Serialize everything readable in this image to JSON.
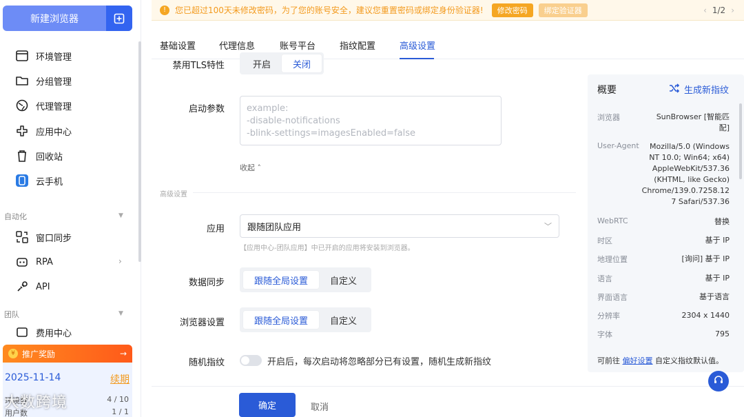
{
  "sidebar": {
    "new_browser_label": "新建浏览器",
    "items": [
      {
        "label": "环境管理",
        "icon": "window-icon"
      },
      {
        "label": "分组管理",
        "icon": "folder-icon"
      },
      {
        "label": "代理管理",
        "icon": "globe-icon"
      },
      {
        "label": "应用中心",
        "icon": "apps-icon"
      },
      {
        "label": "回收站",
        "icon": "trash-icon"
      },
      {
        "label": "云手机",
        "icon": "cloud-phone-icon"
      }
    ],
    "group_automation": "自动化",
    "automation_items": [
      {
        "label": "窗口同步",
        "icon": "sync-window-icon"
      },
      {
        "label": "RPA",
        "icon": "robot-icon"
      },
      {
        "label": "API",
        "icon": "api-icon"
      }
    ],
    "group_team": "团队",
    "team_items": [
      {
        "label": "费用中心",
        "icon": "billing-icon"
      }
    ],
    "promo": {
      "title": "推广奖励",
      "date": "2025-11-14",
      "renew": "续期",
      "rows": [
        {
          "key": "环境数",
          "value": "4 / 10"
        },
        {
          "key": "用户数",
          "value": "1 / 1"
        }
      ]
    },
    "watermark": "大数跨境"
  },
  "notice": {
    "text": "您已超过100天未修改密码，为了您的账号安全，建议您重置密码或绑定身份验证器!",
    "btn_change": "修改密码",
    "btn_bind": "绑定验证器",
    "pager": "1/2"
  },
  "tabs": [
    "基础设置",
    "代理信息",
    "账号平台",
    "指纹配置",
    "高级设置"
  ],
  "active_tab": "高级设置",
  "form": {
    "tls_label": "禁用TLS特性",
    "tls_on": "开启",
    "tls_off": "关闭",
    "launch_label": "启动参数",
    "launch_placeholder": "example:\n-disable-notifications\n-blink-settings=imagesEnabled=false",
    "collapse": "收起",
    "section_advanced": "高级设置",
    "app_label": "应用",
    "app_value": "跟随团队应用",
    "app_hint": "【应用中心-团队应用】中已开启的应用将安装到浏览器。",
    "sync_label": "数据同步",
    "sync_follow": "跟随全局设置",
    "sync_custom": "自定义",
    "browser_label": "浏览器设置",
    "browser_follow": "跟随全局设置",
    "browser_custom": "自定义",
    "random_label": "随机指纹",
    "random_text": "开启后，每次启动将忽略部分已有设置，随机生成新指纹"
  },
  "footer": {
    "ok": "确定",
    "cancel": "取消"
  },
  "overview": {
    "title": "概要",
    "generate": "生成新指纹",
    "rows": [
      {
        "key": "浏览器",
        "value": "SunBrowser [智能匹\n配]"
      },
      {
        "key": "User-Agent",
        "value": "Mozilla/5.0 (Windows\nNT 10.0; Win64; x64)\nAppleWebKit/537.36\n(KHTML, like Gecko)\nChrome/139.0.7258.12\n7 Safari/537.36"
      },
      {
        "key": "WebRTC",
        "value": "替换"
      },
      {
        "key": "时区",
        "value": "基于 IP"
      },
      {
        "key": "地理位置",
        "value": "[询问] 基于 IP"
      },
      {
        "key": "语言",
        "value": "基于 IP"
      },
      {
        "key": "界面语言",
        "value": "基于语言"
      },
      {
        "key": "分辨率",
        "value": "2304 x 1440"
      },
      {
        "key": "字体",
        "value": "795"
      }
    ],
    "foot_prefix": "可前往",
    "foot_link": "偏好设置",
    "foot_suffix": "自定义指纹默认值。"
  },
  "colors": {
    "primary": "#2a5bd7",
    "warning": "#f5a623",
    "promo": "#ff6a1a"
  }
}
